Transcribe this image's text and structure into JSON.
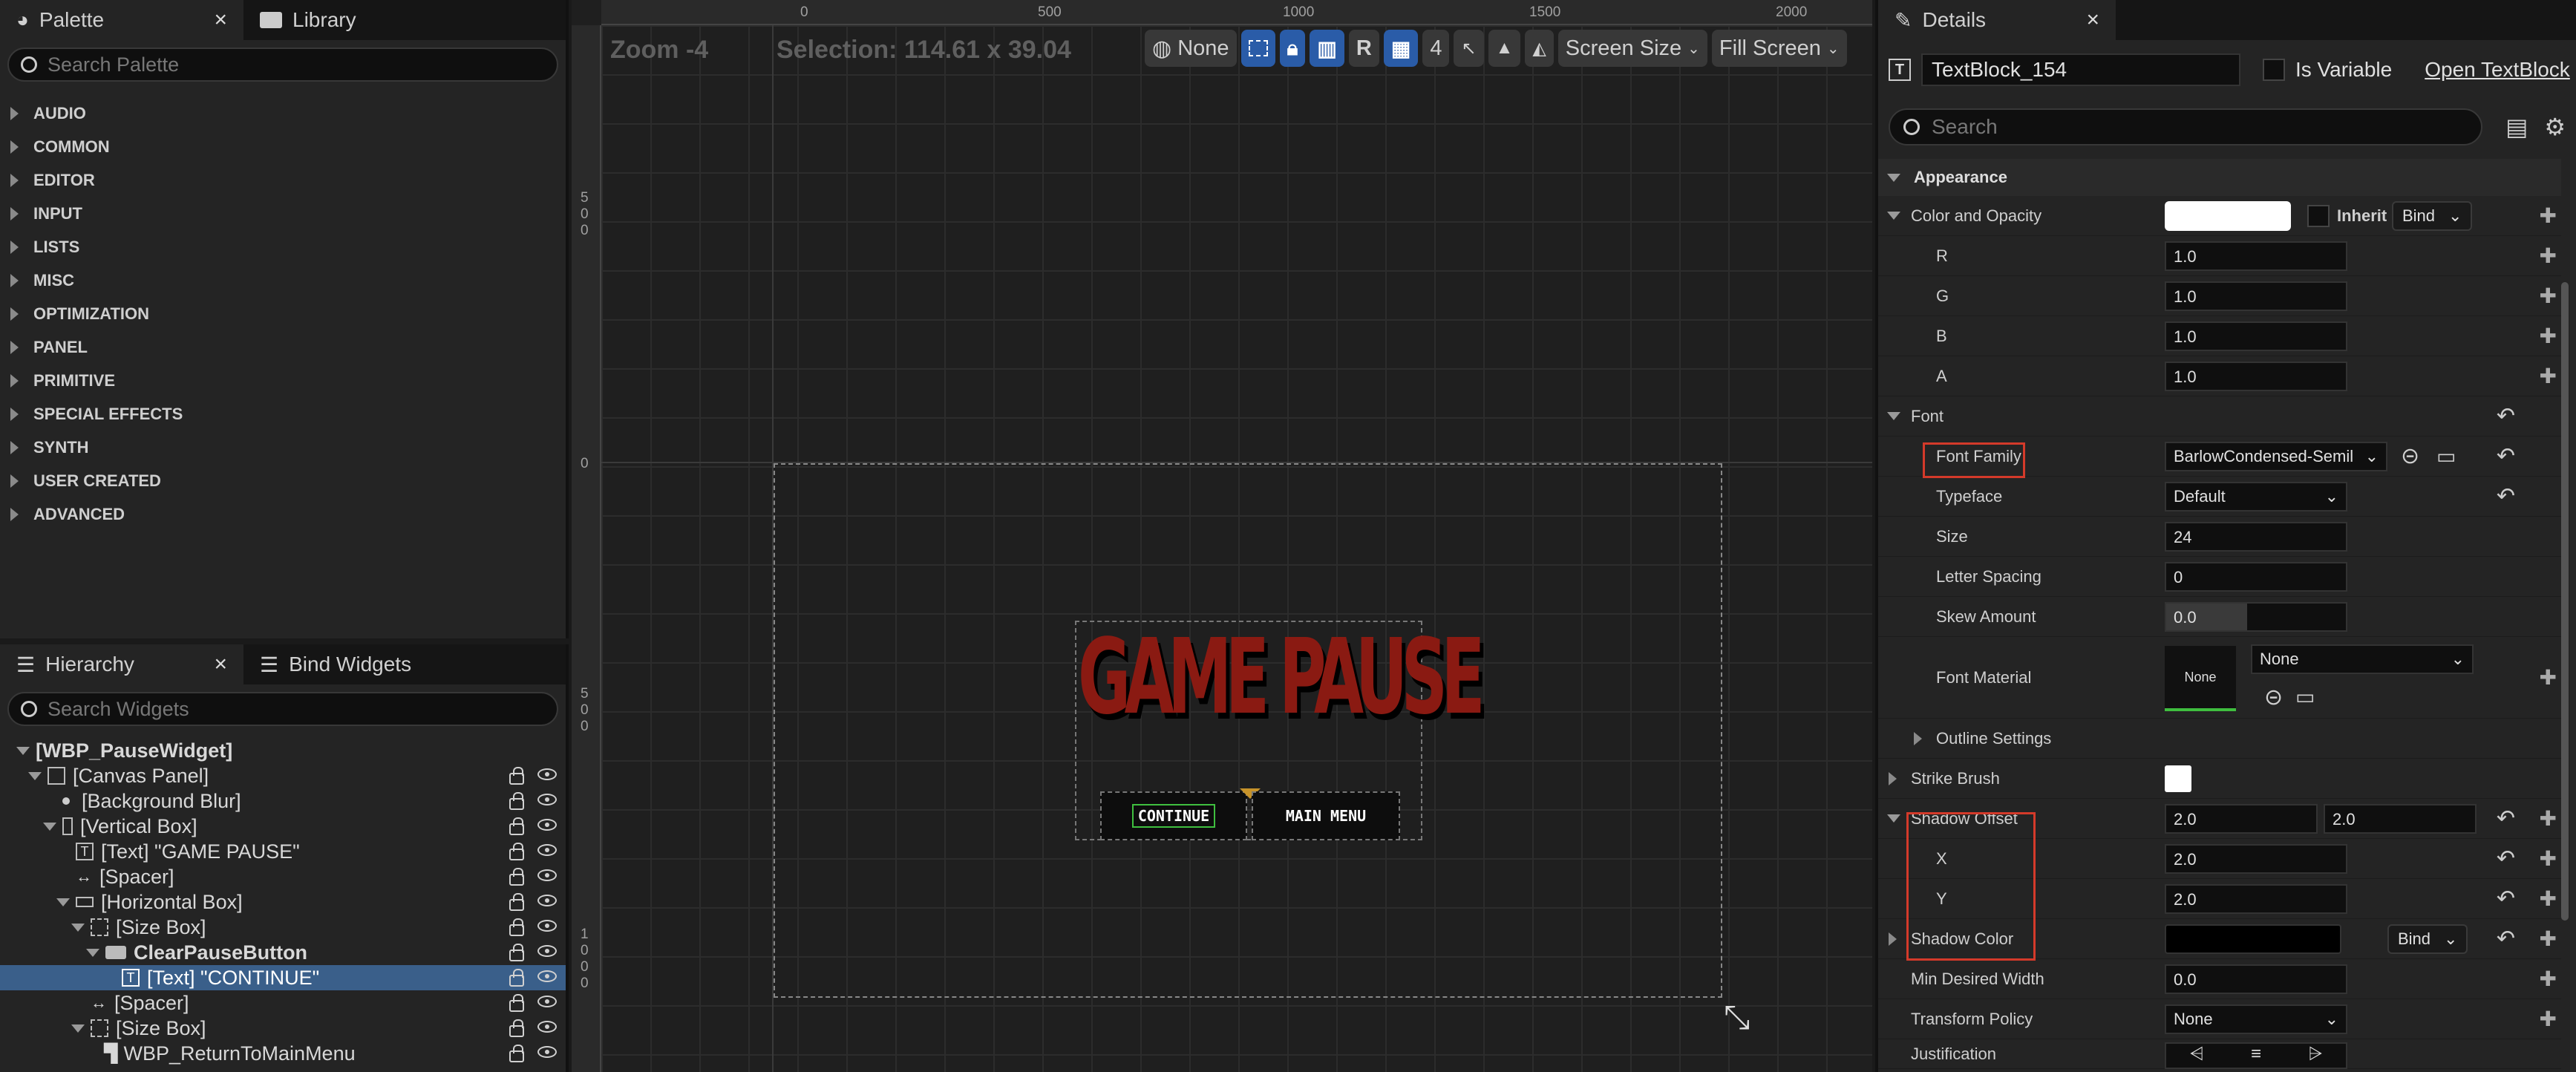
{
  "palette": {
    "tab_label": "Palette",
    "library_tab_label": "Library",
    "close_glyph": "×",
    "search_placeholder": "Search Palette",
    "categories": [
      "AUDIO",
      "COMMON",
      "EDITOR",
      "INPUT",
      "LISTS",
      "MISC",
      "OPTIMIZATION",
      "PANEL",
      "PRIMITIVE",
      "SPECIAL EFFECTS",
      "SYNTH",
      "USER CREATED",
      "ADVANCED"
    ]
  },
  "hierarchy": {
    "tab_label": "Hierarchy",
    "bind_tab_label": "Bind Widgets",
    "close_glyph": "×",
    "search_placeholder": "Search Widgets",
    "nodes": [
      "[WBP_PauseWidget]",
      "[Canvas Panel]",
      "[Background Blur]",
      "[Vertical Box]",
      "[Text] \"GAME PAUSE\"",
      "[Spacer]",
      "[Horizontal Box]",
      "[Size Box]",
      "ClearPauseButton",
      "[Text] \"CONTINUE\"",
      "[Spacer]",
      "[Size Box]",
      "WBP_ReturnToMainMenu"
    ]
  },
  "viewport": {
    "zoom_label": "Zoom -4",
    "selection_label": "Selection: 114.61 x 39.04",
    "ruler_top": [
      "0",
      "500",
      "1000",
      "1500",
      "2000"
    ],
    "ruler_left": [
      "5\n0\n0",
      "0",
      "5\n0\n0",
      "1\n0\n0\n0"
    ],
    "toolbar": {
      "locale_value": "None",
      "r_label": "R",
      "grid_snap_value": "4",
      "screen_size_label": "Screen Size",
      "fill_screen_label": "Fill Screen"
    },
    "preview": {
      "title_text": "GAME PAUSE",
      "continue_text": "CONTINUE",
      "main_menu_text": "MAIN MENU"
    }
  },
  "details": {
    "tab_label": "Details",
    "close_glyph": "×",
    "widget_name": "TextBlock_154",
    "is_variable_label": "Is Variable",
    "open_link": "Open TextBlock",
    "search_placeholder": "Search",
    "sections": {
      "appearance": "Appearance",
      "font": "Font"
    },
    "labels": {
      "color_opacity": "Color and Opacity",
      "inherit": "Inherit",
      "bind": "Bind",
      "r": "R",
      "g": "G",
      "b": "B",
      "a": "A",
      "font_family": "Font Family",
      "typeface": "Typeface",
      "size": "Size",
      "letter_spacing": "Letter Spacing",
      "skew_amount": "Skew Amount",
      "font_material": "Font Material",
      "outline_settings": "Outline Settings",
      "strike_brush": "Strike Brush",
      "shadow_offset": "Shadow Offset",
      "x": "X",
      "y": "Y",
      "shadow_color": "Shadow Color",
      "min_desired_width": "Min Desired Width",
      "transform_policy": "Transform Policy",
      "justification": "Justification"
    },
    "values": {
      "r": "1.0",
      "g": "1.0",
      "b": "1.0",
      "a": "1.0",
      "font_family": "BarlowCondensed-Semil",
      "typeface": "Default",
      "size": "24",
      "letter_spacing": "0",
      "skew_amount": "0.0",
      "font_material_swatch": "None",
      "font_material": "None",
      "shadow_offset_x": "2.0",
      "shadow_offset_y": "2.0",
      "x": "2.0",
      "y": "2.0",
      "min_desired_width": "0.0",
      "transform_policy": "None"
    }
  },
  "colors": {
    "accent_blue": "#2a5ca8",
    "selection_row": "#3a5f8a",
    "highlight_red": "#d43a2a",
    "title_red": "#8a1a12"
  }
}
